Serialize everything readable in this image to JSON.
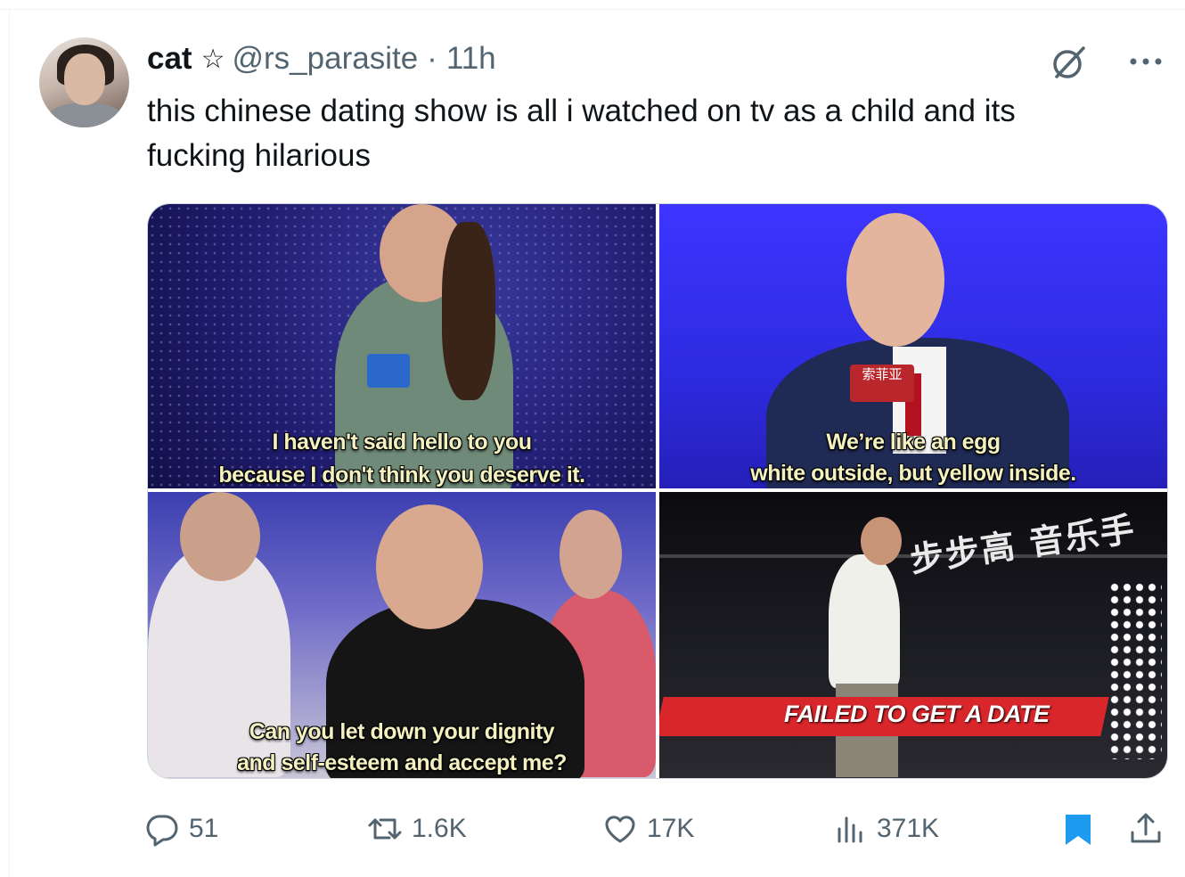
{
  "tweet": {
    "author_name": "cat",
    "handle": "@rs_parasite",
    "separator": "·",
    "time": "11h",
    "text": "this chinese dating show is all i watched on tv as a child and its\nfucking hilarious"
  },
  "media": {
    "panels": [
      {
        "subtitle_line1": "I haven't said hello to you",
        "subtitle_line2": "because I don't think you deserve it."
      },
      {
        "subtitle_line1": "We’re like an egg",
        "subtitle_line2": "white outside, but yellow inside.",
        "mic_tag": "索菲亚"
      },
      {
        "subtitle_line1": "Can you let down your dignity",
        "subtitle_line2": "and self-esteem and accept me?"
      },
      {
        "banner": "FAILED TO GET A DATE",
        "sign": "步步高 音乐手"
      }
    ]
  },
  "actions": {
    "replies": "51",
    "retweets": "1.6K",
    "likes": "17K",
    "views": "371K"
  },
  "colors": {
    "text_primary": "#0f1419",
    "text_secondary": "#536471",
    "bookmark_active": "#1d9bf0"
  },
  "icons": [
    "reply-icon",
    "retweet-icon",
    "like-icon",
    "views-icon",
    "bookmark-icon",
    "share-icon",
    "grok-icon",
    "more-icon",
    "star-icon"
  ]
}
